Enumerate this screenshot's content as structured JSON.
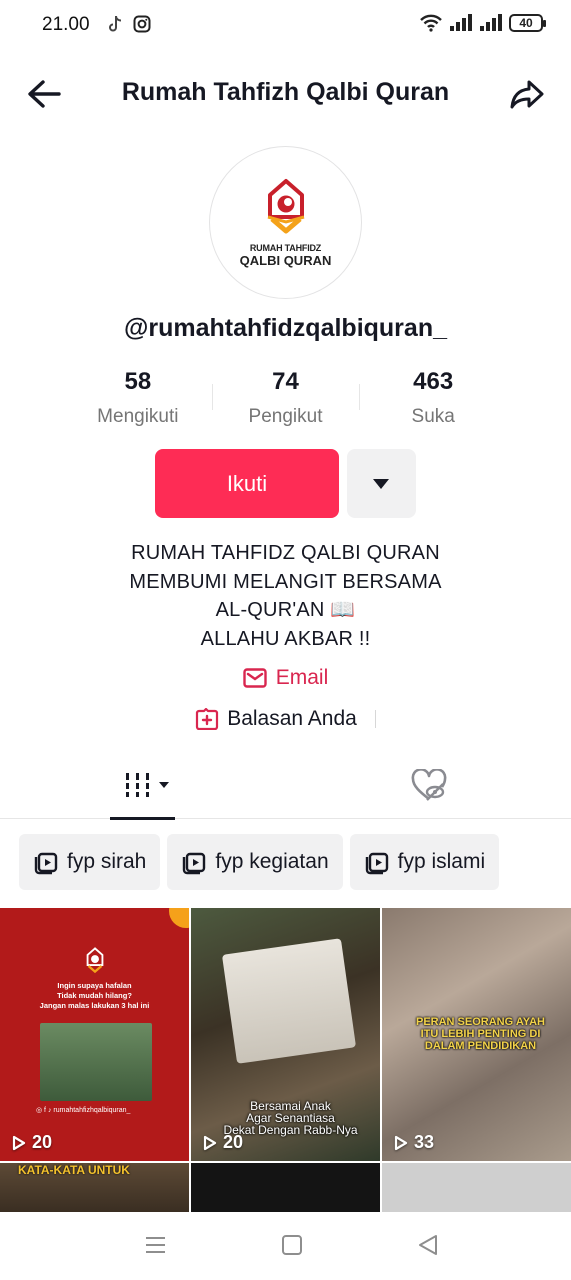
{
  "status_bar": {
    "time": "21.00",
    "battery": "40"
  },
  "header": {
    "title": "Rumah Tahfizh Qalbi Quran"
  },
  "avatar": {
    "line1": "RUMAH TAHFIDZ",
    "line2": "QALBI QURAN"
  },
  "profile": {
    "username": "@rumahtahfidzqalbiquran_",
    "stats": [
      {
        "value": "58",
        "label": "Mengikuti"
      },
      {
        "value": "74",
        "label": "Pengikut"
      },
      {
        "value": "463",
        "label": "Suka"
      }
    ],
    "follow_label": "Ikuti",
    "bio": [
      "RUMAH TAHFIDZ  QALBI QURAN",
      "MEMBUMI MELANGIT BERSAMA",
      "AL-QUR'AN 📖",
      "ALLAHU AKBAR !!"
    ],
    "email_label": "Email",
    "reply_label": "Balasan Anda"
  },
  "playlists": [
    {
      "label": "fyp sirah"
    },
    {
      "label": "fyp kegiatan"
    },
    {
      "label": "fyp islami"
    }
  ],
  "videos": [
    {
      "views": "20",
      "text": [
        "Ingin supaya hafalan",
        "Tidak mudah hilang?",
        "Jangan malas lakukan 3 hal ini"
      ],
      "handle": "rumahtahfizhqalbiquran_"
    },
    {
      "views": "20",
      "caption": [
        "Bersamai Anak",
        "Agar Senantiasa",
        "Dekat Dengan Rabb-Nya"
      ]
    },
    {
      "views": "33",
      "caption": [
        "PERAN SEORANG AYAH",
        "ITU LEBIH PENTING DI",
        "DALAM PENDIDIKAN"
      ]
    },
    {
      "caption": "KATA-KATA UNTUK"
    }
  ],
  "colors": {
    "accent": "#fe2c55",
    "email": "#d9264f",
    "text": "#161823",
    "muted": "#757575"
  }
}
